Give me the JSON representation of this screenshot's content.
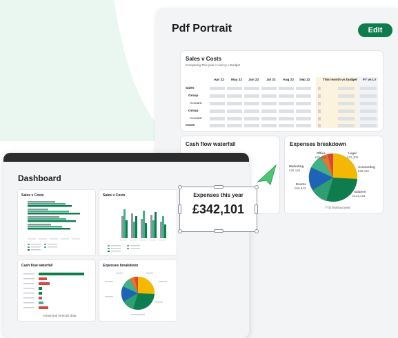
{
  "pdf": {
    "title": "Pdf Portrait",
    "edit_label": "Edit",
    "sales_table": {
      "title": "Sales v Costs",
      "subtitle": "Comparing This year v Last yr v Budget",
      "columns": [
        "Apr 22",
        "May 22",
        "Jun 22",
        "Jul 22",
        "Aug 22",
        "Sep 22",
        "This month vs budget",
        "FY vs LY"
      ],
      "rows": [
        "Sales",
        "Group",
        "Account",
        "Group",
        "Account",
        "Costs"
      ]
    },
    "cashflow_title": "Cash flow waterfall",
    "expenses": {
      "title": "Expenses breakdown",
      "labels": [
        {
          "name": "Office",
          "value": "£21,053"
        },
        {
          "name": "Legal",
          "value": "£22,305"
        },
        {
          "name": "Marketing",
          "value": "£25,145"
        },
        {
          "name": "Accounting",
          "value": "£38,115"
        },
        {
          "name": "Events",
          "value": "£56,943"
        },
        {
          "name": "Salaries",
          "value": "£141,231"
        }
      ],
      "footer": "YTD financial year"
    }
  },
  "dashboard": {
    "title": "Dashboard",
    "sales_card_1": "Sales v Costs",
    "sales_card_2": "Sales v Costs",
    "cashflow": {
      "title": "Cash flow waterfall",
      "footer": "Actual and forecast data"
    },
    "expenses_title": "Expenses breakdown"
  },
  "callout": {
    "label": "Expenses this year",
    "value": "£342,101"
  },
  "colors": {
    "brand_green": "#0f7c4d",
    "teal": "#3fb28a",
    "yellow": "#f5b800",
    "blue": "#1e63b5",
    "red": "#d8473f",
    "orange": "#e8752a",
    "highlight": "#fbf3dd"
  }
}
